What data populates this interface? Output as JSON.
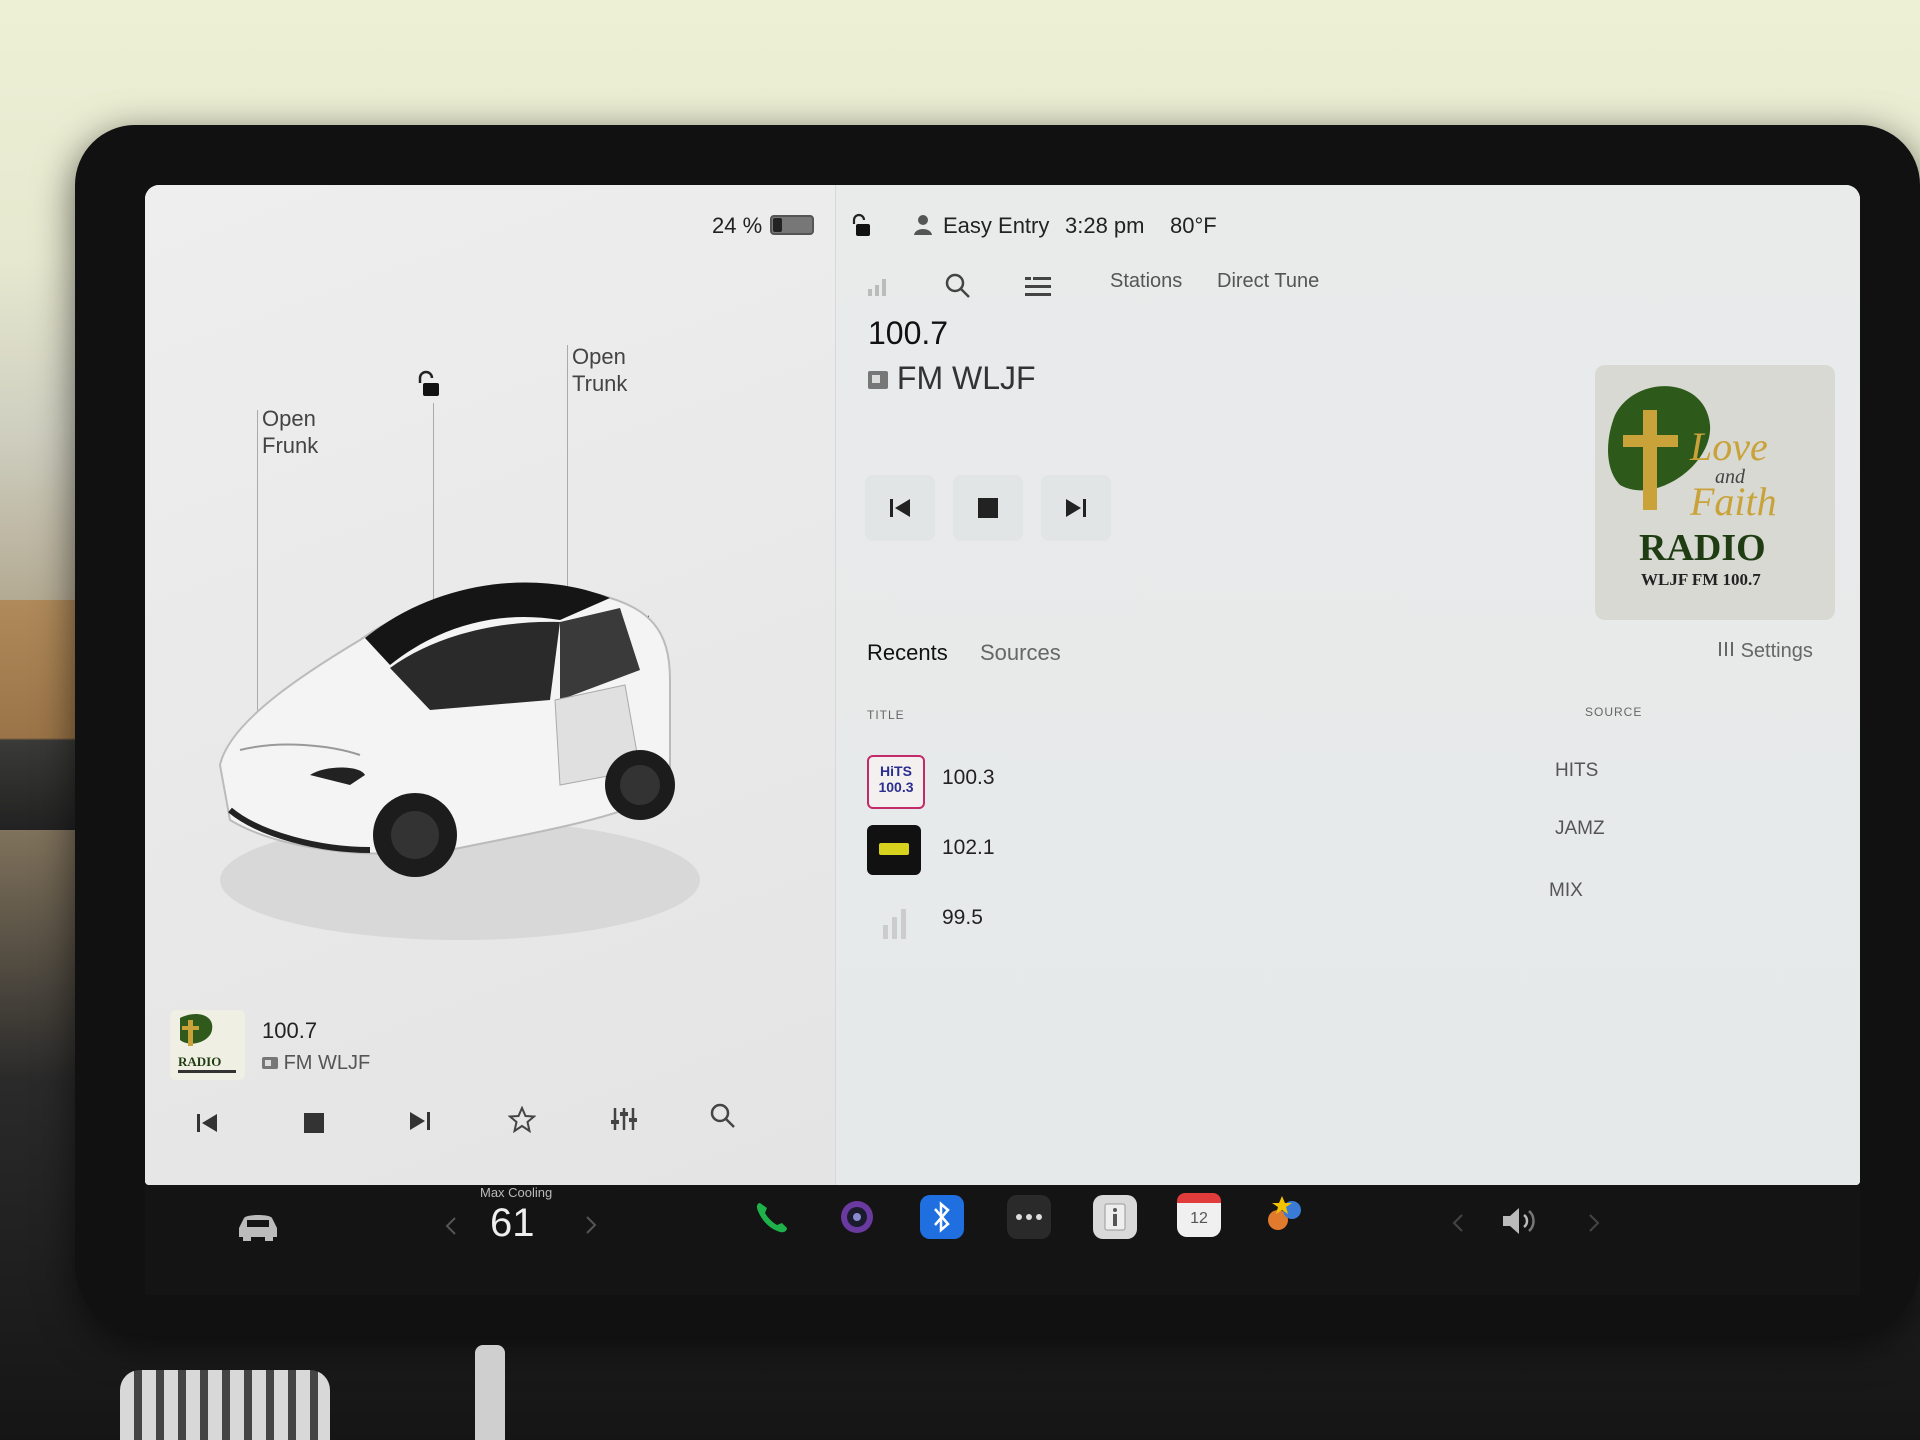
{
  "status": {
    "battery_percent_text": "24 %",
    "battery_level": 0.24,
    "profile": "Easy Entry",
    "time": "3:28 pm",
    "temperature": "80°F"
  },
  "car_view": {
    "frunk_line1": "Open",
    "frunk_line2": "Frunk",
    "trunk_line1": "Open",
    "trunk_line2": "Trunk"
  },
  "mini_player": {
    "frequency": "100.7",
    "station": "FM WLJF",
    "art_lines": [
      "RADIO"
    ]
  },
  "radio": {
    "nav_tabs": [
      "Stations",
      "Direct Tune"
    ],
    "frequency": "100.7",
    "station": "FM WLJF",
    "art": {
      "line1": "Love",
      "line2": "and",
      "line3": "Faith",
      "line4": "RADIO",
      "line5": "WLJF FM 100.7"
    },
    "list_tabs": [
      "Recents",
      "Sources"
    ],
    "settings_label": "Settings",
    "columns": {
      "title": "TITLE",
      "source": "SOURCE"
    },
    "recents": [
      {
        "title": "100.3",
        "source": "HITS",
        "logo_text": "HiTS 100.3"
      },
      {
        "title": "102.1",
        "source": "JAMZ",
        "logo_text": ""
      },
      {
        "title": "99.5",
        "source": "MIX",
        "logo_text": ""
      }
    ]
  },
  "dock": {
    "temp_label": "Max Cooling",
    "temp_value": "61",
    "calendar_day": "12"
  },
  "colors": {
    "accent_green": "#1fb24a",
    "bluetooth_blue": "#1f6fe0",
    "calendar_red": "#e13b3b"
  }
}
